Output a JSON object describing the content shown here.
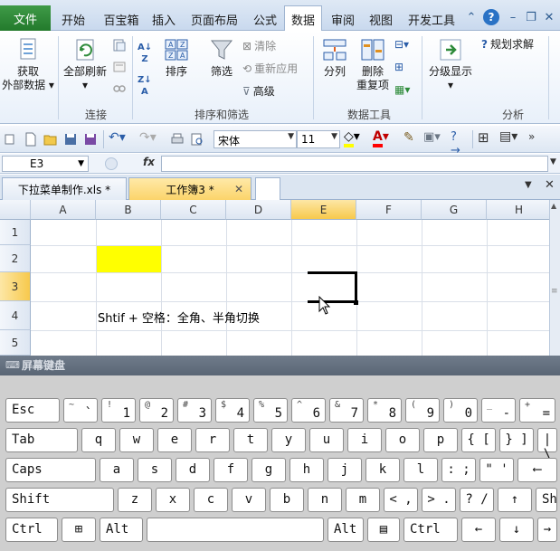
{
  "ribbon_tabs": [
    "文件",
    "开始",
    "百宝箱",
    "插入",
    "页面布局",
    "公式",
    "数据",
    "审阅",
    "视图",
    "开发工具"
  ],
  "active_tab": "数据",
  "ribbon": {
    "get_external_data": [
      "获取",
      "外部数据"
    ],
    "refresh_all": "全部刷新",
    "group_connections": "连接",
    "sort": "排序",
    "filter": "筛选",
    "clear": "清除",
    "reapply": "重新应用",
    "advanced": "高级",
    "group_sort_filter": "排序和筛选",
    "text_to_columns": "分列",
    "remove_duplicates": [
      "删除",
      "重复项"
    ],
    "group_data_tools": "数据工具",
    "outline": "分级显示",
    "solver": "规划求解",
    "group_analysis": "分析"
  },
  "toolbar": {
    "font_name": "宋体",
    "font_size": "11"
  },
  "formula_bar": {
    "cell_ref": "E3",
    "fx": "fx",
    "formula": ""
  },
  "workbook_tabs": [
    "下拉菜单制作.xls *",
    "工作簿3 *"
  ],
  "grid": {
    "columns": [
      "A",
      "B",
      "C",
      "D",
      "E",
      "F",
      "G",
      "H"
    ],
    "rows": [
      "1",
      "2",
      "3",
      "4",
      "5"
    ],
    "selected_column": "E",
    "selected_row": "3",
    "note_text": "Shtif + 空格：全角、半角切换",
    "highlight_color": "#ffff00"
  },
  "keyboard": {
    "title": "屏幕键盘",
    "row1": [
      {
        "main": "Esc"
      },
      {
        "up": "~",
        "dn": "`"
      },
      {
        "up": "!",
        "dn": "1"
      },
      {
        "up": "@",
        "dn": "2"
      },
      {
        "up": "#",
        "dn": "3"
      },
      {
        "up": "$",
        "dn": "4"
      },
      {
        "up": "%",
        "dn": "5"
      },
      {
        "up": "^",
        "dn": "6"
      },
      {
        "up": "&",
        "dn": "7"
      },
      {
        "up": "*",
        "dn": "8"
      },
      {
        "up": "(",
        "dn": "9"
      },
      {
        "up": ")",
        "dn": "0"
      },
      {
        "up": "_",
        "dn": "-"
      },
      {
        "up": "+",
        "dn": "="
      }
    ],
    "row2": [
      "Tab",
      "q",
      "w",
      "e",
      "r",
      "t",
      "y",
      "u",
      "i",
      "o",
      "p",
      "{ [",
      "} ]",
      "| \\"
    ],
    "row3": [
      "Caps",
      "a",
      "s",
      "d",
      "f",
      "g",
      "h",
      "j",
      "k",
      "l",
      ": ;",
      "\" '",
      "⟵"
    ],
    "row4": [
      "Shift",
      "z",
      "x",
      "c",
      "v",
      "b",
      "n",
      "m",
      "< ,",
      "> .",
      "? /",
      "↑",
      "Sh"
    ],
    "row5": [
      "Ctrl",
      "⊞",
      "Alt",
      "",
      "Alt",
      "▤",
      "Ctrl",
      "←",
      "↓",
      "→"
    ]
  }
}
